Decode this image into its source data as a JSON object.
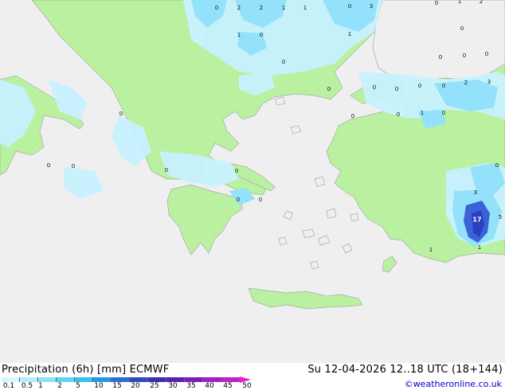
{
  "title": {
    "left": "Precipitation (6h) [mm] ECMWF",
    "right": "Su 12-04-2026 12..18 UTC (18+144)"
  },
  "legend": {
    "ticks": [
      "0.1",
      "0.5",
      "1",
      "2",
      "5",
      "10",
      "15",
      "20",
      "25",
      "30",
      "35",
      "40",
      "45",
      "50"
    ],
    "colors": [
      "#d6f7ff",
      "#b3eefc",
      "#8ce2f7",
      "#5fd3f2",
      "#33c2ee",
      "#1f9ae8",
      "#2e6fd6",
      "#2d48c4",
      "#3a2fb3",
      "#5a20b8",
      "#7d1ec2",
      "#a01ecb",
      "#c21ecf",
      "#e61ecf"
    ]
  },
  "credit": "©weatheronline.co.uk",
  "colors": {
    "sea": "#efefef",
    "land": "#b9f1a1",
    "coast": "#a9a9a9",
    "precip_light": "#c8f2ff",
    "precip_mid": "#93e1fb",
    "precip_heavy": "#3b63d8",
    "precip_core": "#2a3fbf"
  },
  "map_labels": [
    {
      "text": "0"
    },
    {
      "text": "2"
    },
    {
      "text": "2"
    },
    {
      "text": "1"
    },
    {
      "text": "1"
    },
    {
      "text": "0"
    },
    {
      "text": "3"
    },
    {
      "text": "0"
    },
    {
      "text": "1"
    },
    {
      "text": "2"
    },
    {
      "text": "1"
    },
    {
      "text": "0"
    },
    {
      "text": "1"
    },
    {
      "text": "0"
    },
    {
      "text": "0"
    },
    {
      "text": "0"
    },
    {
      "text": "0"
    },
    {
      "text": "0"
    },
    {
      "text": "0"
    },
    {
      "text": "0"
    },
    {
      "text": "0"
    },
    {
      "text": "2"
    },
    {
      "text": "3"
    },
    {
      "text": "0"
    },
    {
      "text": "0"
    },
    {
      "text": "0"
    },
    {
      "text": "1"
    },
    {
      "text": "0"
    },
    {
      "text": "0"
    },
    {
      "text": "0"
    },
    {
      "text": "0"
    },
    {
      "text": "0"
    },
    {
      "text": "0"
    },
    {
      "text": "0"
    },
    {
      "text": "0"
    },
    {
      "text": "0"
    },
    {
      "text": "0"
    },
    {
      "text": "3"
    },
    {
      "text": "17"
    },
    {
      "text": "5"
    },
    {
      "text": "1"
    },
    {
      "text": "1"
    }
  ]
}
